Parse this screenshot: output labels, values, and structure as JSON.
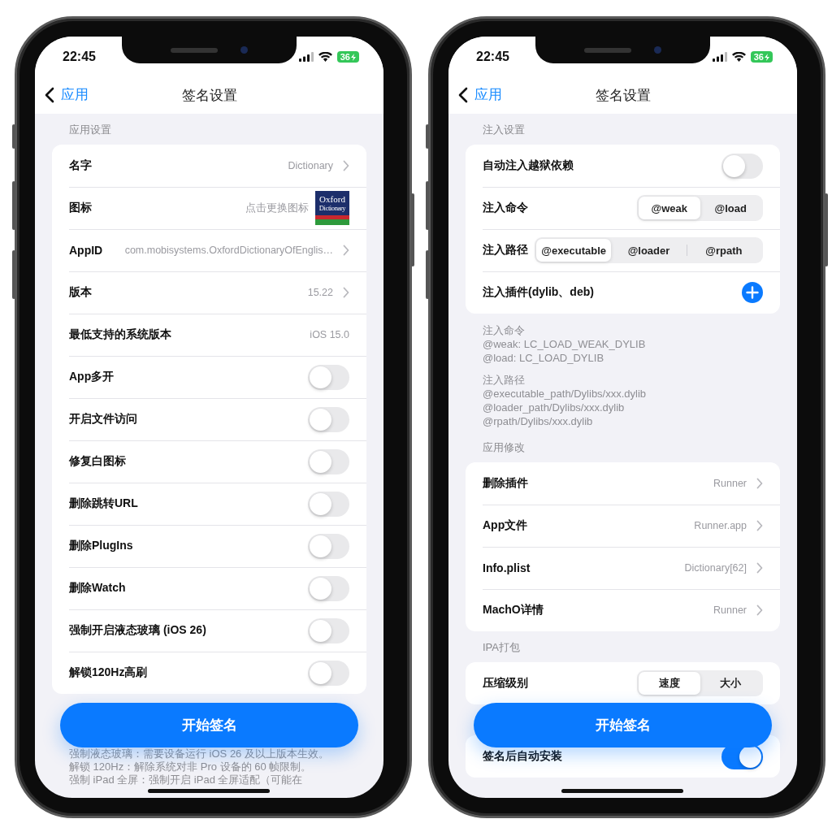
{
  "phones": [
    {
      "status": {
        "time": "22:45",
        "battery": "36"
      },
      "nav": {
        "back": "应用",
        "title": "签名设置"
      },
      "sections": [
        {
          "header": "应用设置",
          "rows": [
            {
              "kind": "value",
              "label": "名字",
              "value": "Dictionary",
              "chevron": true
            },
            {
              "kind": "icon",
              "label": "图标",
              "hint": "点击更换图标",
              "logo": [
                "Oxford",
                "Dictionary"
              ]
            },
            {
              "kind": "value",
              "label": "AppID",
              "value": "com.mobisystems.OxfordDictionaryOfEnglis…",
              "chevron": true
            },
            {
              "kind": "value",
              "label": "版本",
              "value": "15.22",
              "chevron": true
            },
            {
              "kind": "value",
              "label": "最低支持的系统版本",
              "value": "iOS 15.0",
              "chevron": false
            },
            {
              "kind": "toggle",
              "label": "App多开",
              "on": false
            },
            {
              "kind": "toggle",
              "label": "开启文件访问",
              "on": false
            },
            {
              "kind": "toggle",
              "label": "修复白图标",
              "on": false
            },
            {
              "kind": "toggle",
              "label": "删除跳转URL",
              "on": false
            },
            {
              "kind": "toggle",
              "label": "删除PlugIns",
              "on": false
            },
            {
              "kind": "toggle",
              "label": "删除Watch",
              "on": false
            },
            {
              "kind": "toggle",
              "label": "强制开启液态玻璃 (iOS 26)",
              "on": false
            },
            {
              "kind": "toggle",
              "label": "解锁120Hz高刷",
              "on": false
            }
          ]
        }
      ],
      "footer_notes": [
        "强制液态玻璃：需要设备运行 iOS 26 及以上版本生效。",
        "解锁 120Hz：解除系统对非 Pro 设备的 60 帧限制。",
        "强制 iPad 全屏：强制开启 iPad 全屏适配（可能在"
      ],
      "action": "开始签名"
    },
    {
      "status": {
        "time": "22:45",
        "battery": "36"
      },
      "nav": {
        "back": "应用",
        "title": "签名设置"
      },
      "sections": [
        {
          "header": "注入设置",
          "rows": [
            {
              "kind": "toggle",
              "label": "自动注入越狱依赖",
              "on": false
            },
            {
              "kind": "segmented",
              "label": "注入命令",
              "options": [
                {
                  "label": "@weak",
                  "selected": true
                },
                {
                  "label": "@load",
                  "selected": false
                }
              ]
            },
            {
              "kind": "segmented",
              "label": "注入路径",
              "options": [
                {
                  "label": "@executable",
                  "selected": true
                },
                {
                  "label": "@loader",
                  "selected": false
                },
                {
                  "label": "@rpath",
                  "selected": false
                }
              ]
            },
            {
              "kind": "add",
              "label": "注入插件(dylib、deb)"
            }
          ],
          "notes": [
            [
              "注入命令",
              "@weak: LC_LOAD_WEAK_DYLIB",
              "@load: LC_LOAD_DYLIB"
            ],
            [
              "注入路径",
              "@executable_path/Dylibs/xxx.dylib",
              "@loader_path/Dylibs/xxx.dylib",
              "@rpath/Dylibs/xxx.dylib"
            ]
          ]
        },
        {
          "header": "应用修改",
          "rows": [
            {
              "kind": "value",
              "label": "删除插件",
              "value": "Runner",
              "chevron": true
            },
            {
              "kind": "value",
              "label": "App文件",
              "value": "Runner.app",
              "chevron": true
            },
            {
              "kind": "value",
              "label": "Info.plist",
              "value": "Dictionary[62]",
              "chevron": true
            },
            {
              "kind": "value",
              "label": "MachO详情",
              "value": "Runner",
              "chevron": true
            }
          ]
        },
        {
          "header": "IPA打包",
          "rows": [
            {
              "kind": "segmented",
              "label": "压缩级别",
              "options": [
                {
                  "label": "速度",
                  "selected": true
                },
                {
                  "label": "大小",
                  "selected": false
                }
              ]
            }
          ]
        },
        {
          "rows": [
            {
              "kind": "toggle",
              "label": "签名后自动安装",
              "on": true
            }
          ]
        }
      ],
      "action": "开始签名"
    }
  ]
}
